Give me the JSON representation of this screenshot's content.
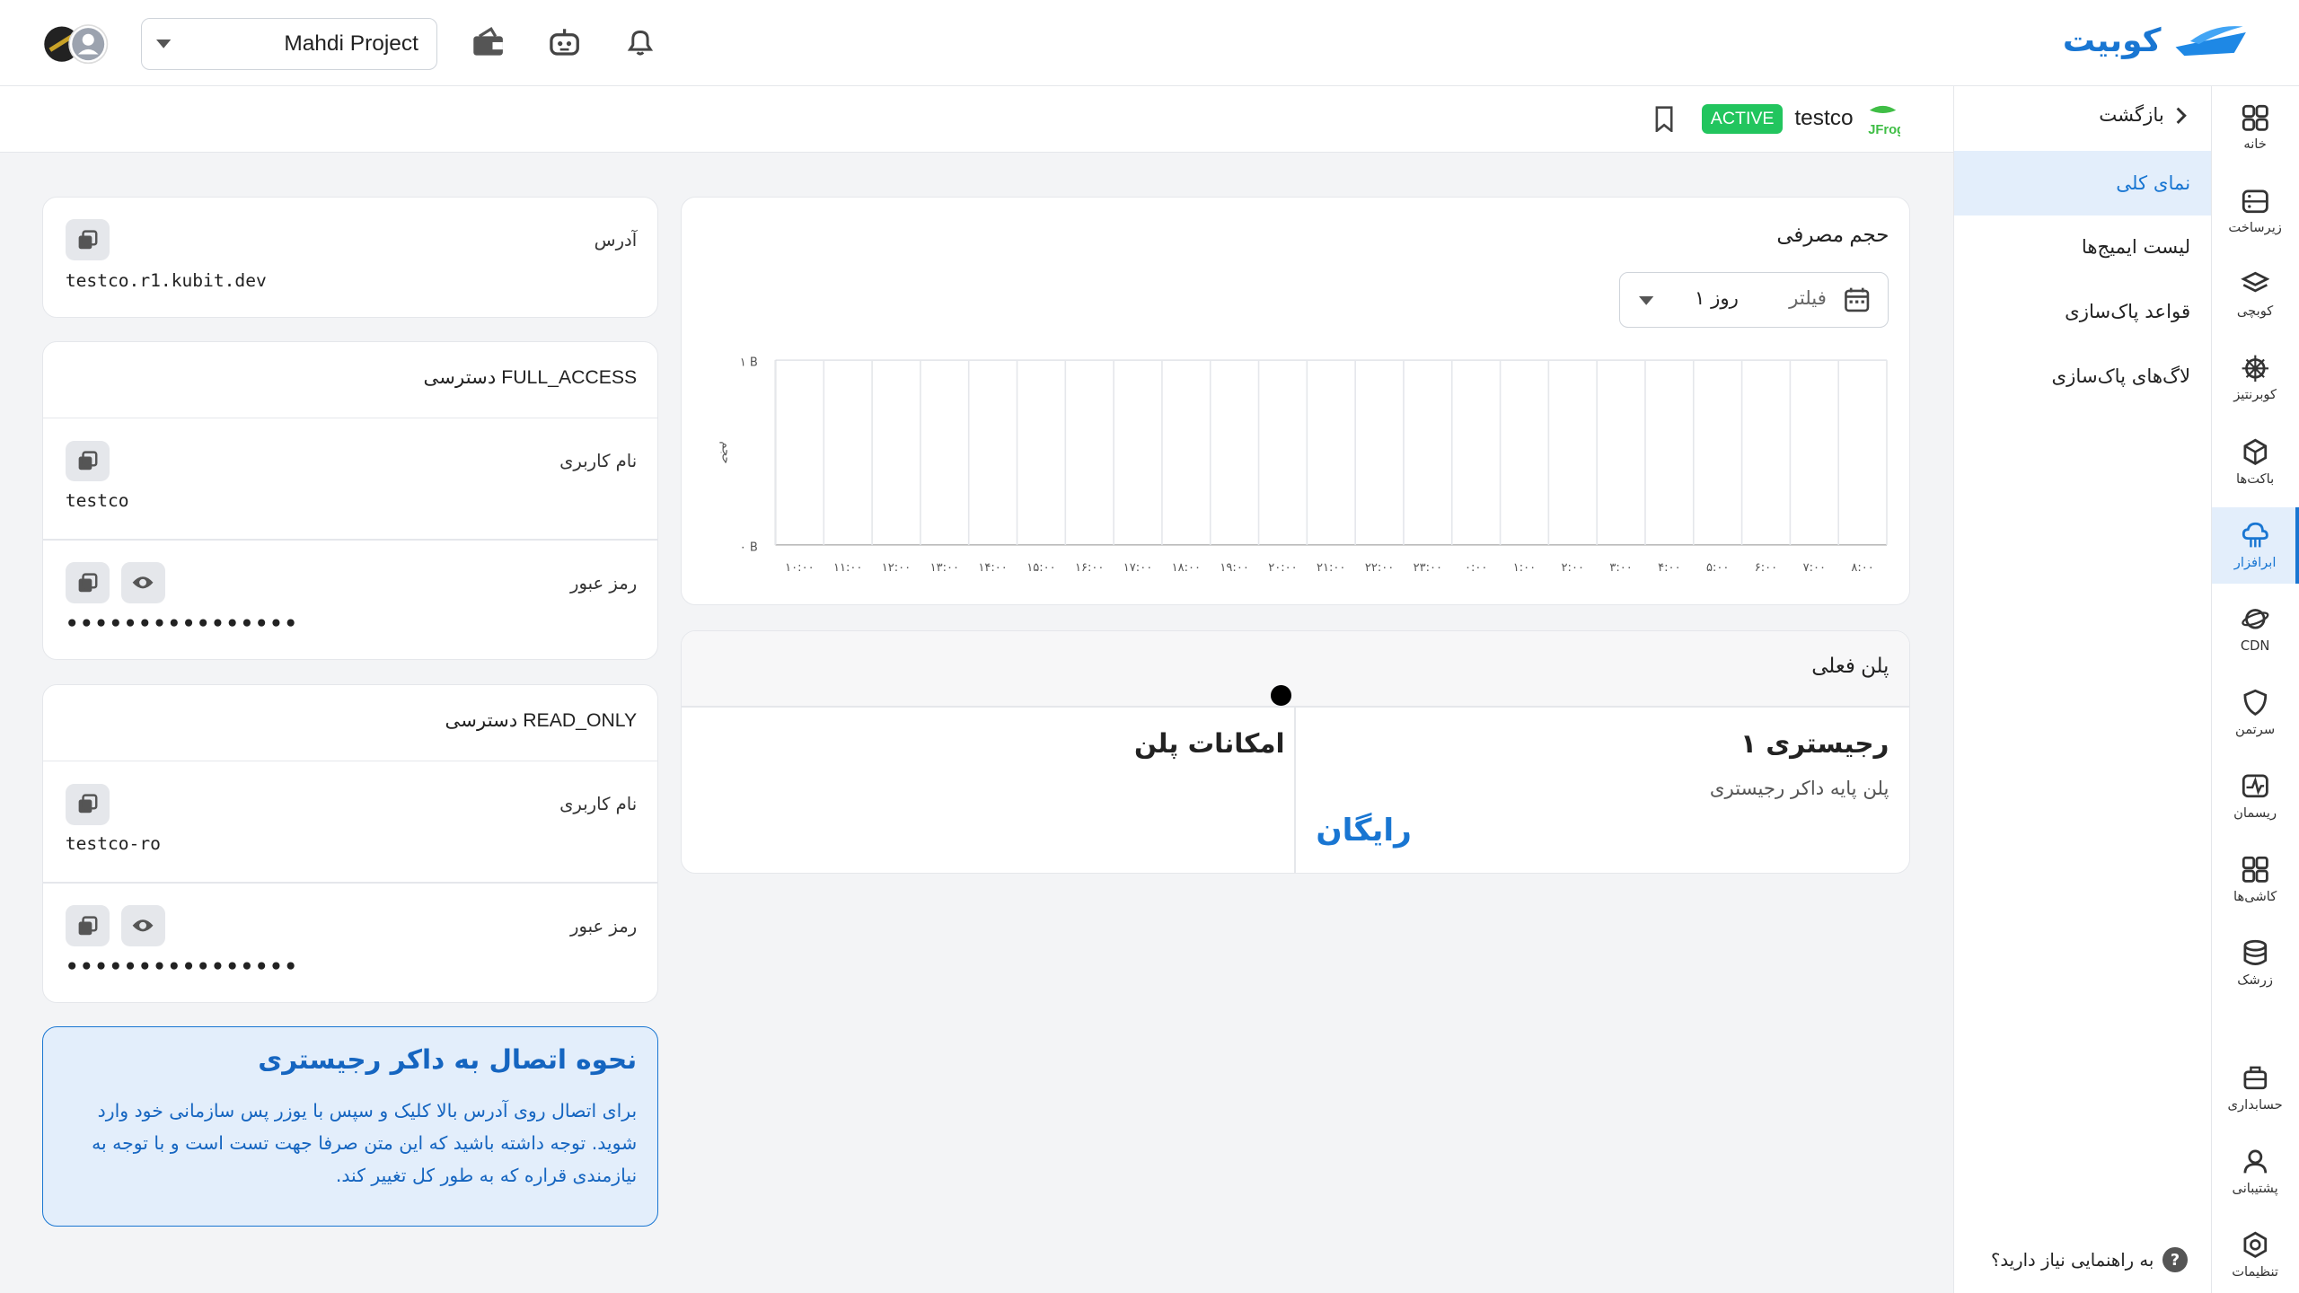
{
  "brand": {
    "name": "کوبیت"
  },
  "topbar": {
    "project": "Mahdi Project",
    "icons": [
      "wallet-icon",
      "robot-icon",
      "bell-icon"
    ]
  },
  "rail": [
    {
      "label": "خانه",
      "icon": "grid-icon"
    },
    {
      "label": "زیرساخت",
      "icon": "server-icon"
    },
    {
      "label": "کوبچی",
      "icon": "layers-icon"
    },
    {
      "label": "کوبرنتیز",
      "icon": "helm-icon"
    },
    {
      "label": "باکت‌ها",
      "icon": "cube-icon"
    },
    {
      "label": "ابرافزار",
      "icon": "cloud-icon",
      "active": true
    },
    {
      "label": "CDN",
      "icon": "planet-icon"
    },
    {
      "label": "سرتمن",
      "icon": "shield-icon"
    },
    {
      "label": "ریسمان",
      "icon": "pulse-icon"
    },
    {
      "label": "کاشی‌ها",
      "icon": "tiles-icon"
    },
    {
      "label": "زرشک",
      "icon": "stack-icon"
    },
    {
      "label": "حسابداری",
      "icon": "accounting-icon"
    },
    {
      "label": "پشتیبانی",
      "icon": "support-icon"
    },
    {
      "label": "تنظیمات",
      "icon": "settings-icon"
    }
  ],
  "subnav": {
    "back": "بازگشت",
    "items": [
      {
        "label": "نمای کلی",
        "active": true
      },
      {
        "label": "لیست ایمیج‌ها"
      },
      {
        "label": "قواعد پاک‌سازی"
      },
      {
        "label": "لاگ‌های پاک‌سازی"
      }
    ],
    "help": "به راهنمایی نیاز دارید؟"
  },
  "header": {
    "name": "testco",
    "status": "ACTIVE",
    "logo_text": "JFrog"
  },
  "address": {
    "label": "آدرس",
    "value": "testco.r1.kubit.dev"
  },
  "full_access": {
    "title": "دسترسی FULL_ACCESS",
    "username_label": "نام کاربری",
    "username": "testco",
    "password_label": "رمز عبور",
    "password": "••••••••••••••••"
  },
  "read_only": {
    "title": "دسترسی READ_ONLY",
    "username_label": "نام کاربری",
    "username": "testco-ro",
    "password_label": "رمز عبور",
    "password": "••••••••••••••••"
  },
  "info": {
    "title": "نحوه اتصال به داکر رجیستری",
    "body": "برای اتصال روی آدرس بالا کلیک و سپس با یوزر پس سازمانی خود وارد شوید. توجه داشته باشید که این متن صرفا جهت تست است و با توجه به نیازمندی قراره که به طور کل تغییر کند."
  },
  "usage": {
    "title": "حجم مصرفی",
    "filter_label": "فیلتر",
    "filter_value": "۱ روز"
  },
  "chart_data": {
    "type": "bar",
    "title": "حجم مصرفی",
    "xlabel": "",
    "ylabel": "حجم",
    "ytick_labels": [
      "۰ B",
      "۱ B"
    ],
    "ylim": [
      0,
      1
    ],
    "categories": [
      "۱۰:۰۰",
      "۱۱:۰۰",
      "۱۲:۰۰",
      "۱۳:۰۰",
      "۱۴:۰۰",
      "۱۵:۰۰",
      "۱۶:۰۰",
      "۱۷:۰۰",
      "۱۸:۰۰",
      "۱۹:۰۰",
      "۲۰:۰۰",
      "۲۱:۰۰",
      "۲۲:۰۰",
      "۲۳:۰۰",
      "۰:۰۰",
      "۱:۰۰",
      "۲:۰۰",
      "۳:۰۰",
      "۴:۰۰",
      "۵:۰۰",
      "۶:۰۰",
      "۷:۰۰",
      "۸:۰۰"
    ],
    "values": [
      0,
      0,
      0,
      0,
      0,
      0,
      0,
      0,
      0,
      0,
      0,
      0,
      0,
      0,
      0,
      0,
      0,
      0,
      0,
      0,
      0,
      0,
      0
    ],
    "grid": true
  },
  "plan": {
    "section_title": "پلن فعلی",
    "name": "رجیستری ۱",
    "description": "پلن پایه داکر رجیستری",
    "price": "رایگان",
    "features_title": "امکانات پلن"
  }
}
